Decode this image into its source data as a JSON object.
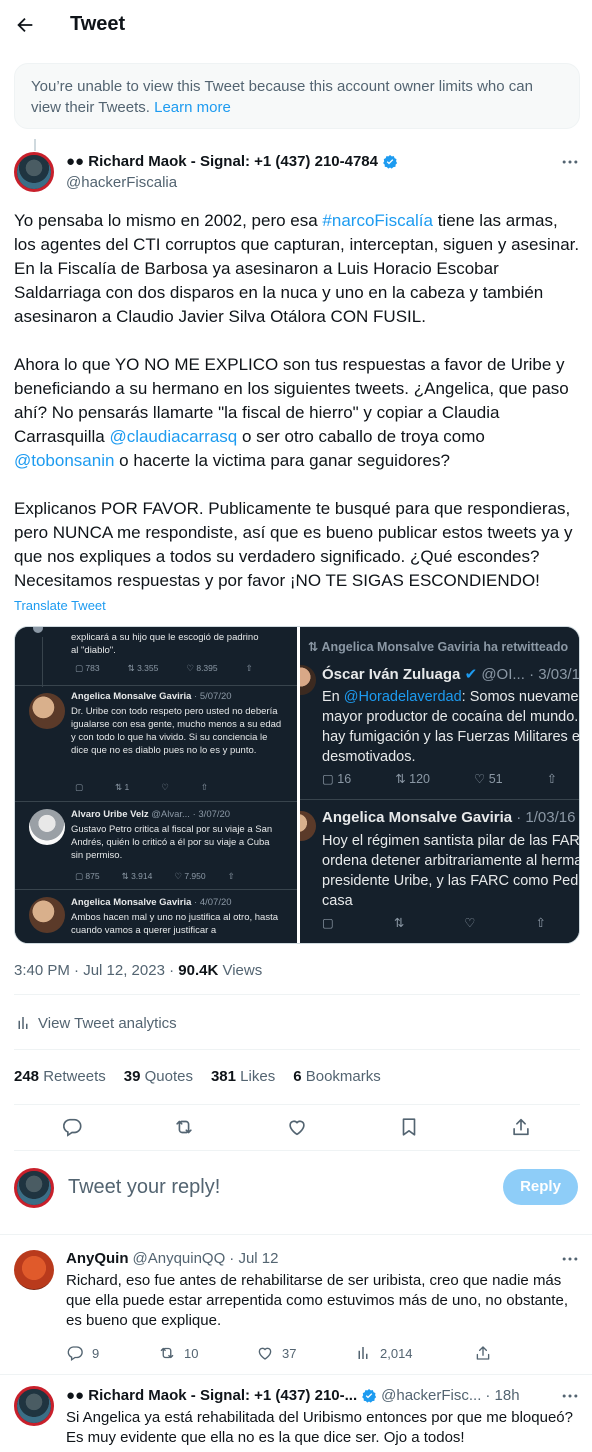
{
  "header": {
    "title": "Tweet"
  },
  "notice": {
    "text": "You’re unable to view this Tweet because this account owner limits who can view their Tweets.",
    "link": "Learn more"
  },
  "tweet": {
    "display_name": "●● Richard Maok - Signal: +1 (437) 210-4784",
    "handle": "@hackerFiscalia",
    "paragraph1_a": "Yo pensaba lo mismo en 2002, pero esa ",
    "paragraph1_hashtag": "#narcoFiscalía",
    "paragraph1_b": " tiene las armas, los agentes del CTI corruptos que capturan, interceptan, siguen y asesinar. En la Fiscalía de Barbosa ya asesinaron a Luis Horacio Escobar Saldarriaga con dos disparos en la nuca y uno en la cabeza y también asesinaron a Claudio Javier Silva Otálora CON FUSIL.",
    "paragraph2_a": "Ahora lo que YO NO ME EXPLICO son tus respuestas a favor de Uribe y beneficiando a su hermano en los siguientes tweets. ¿Angelica, que paso ahí? No pensarás llamarte \"la fiscal de hierro\" y copiar a Claudia Carrasquilla ",
    "paragraph2_mention1": "@claudiacarrasq",
    "paragraph2_b": " o ser otro caballo de troya como ",
    "paragraph2_mention2": "@tobonsanin",
    "paragraph2_c": " o hacerte la victima para ganar seguidores?",
    "paragraph3": "Explicanos POR FAVOR. Publicamente te busqué para que respondieras, pero NUNCA me respondiste, así que es bueno publicar estos tweets ya y que nos expliques a todos su verdadero significado. ¿Qué escondes? Necesitamos respuestas y por favor ¡NO TE SIGAS ESCONDIENDO!",
    "translate": "Translate Tweet",
    "time": "3:40 PM · Jul 12, 2023 · ",
    "views_count": "90.4K",
    "views_label": " Views",
    "analytics": "View Tweet analytics",
    "retweets_count": "248",
    "retweets_label": "Retweets",
    "quotes_count": "39",
    "quotes_label": "Quotes",
    "likes_count": "381",
    "likes_label": "Likes",
    "bookmarks_count": "6",
    "bookmarks_label": "Bookmarks"
  },
  "media": {
    "left": {
      "top_text": "explicará a su hijo que le escogió de padrino al \"diablo\".",
      "top_stats": [
        "783",
        "3.355",
        "8.395"
      ],
      "t1_name": "Angelica Monsalve Gaviria",
      "t1_date": "· 5/07/20",
      "t1_text": "Dr. Uribe con todo respeto pero usted no debería igualarse con esa gente, mucho menos a su edad y con todo lo que ha vivido. Si su conciencia le dice que no es diablo pues no lo es y punto.",
      "t1_stats": [
        "",
        "1",
        ""
      ],
      "t2_name": "Alvaro Uribe Velz",
      "t2_handle": "@Alvar...",
      "t2_date": "· 3/07/20",
      "t2_text": "Gustavo Petro critica al fiscal por su viaje a San Andrés, quién lo criticó a él por su viaje a Cuba sin permiso.",
      "t2_stats": [
        "875",
        "3.914",
        "7.950"
      ],
      "t3_name": "Angelica Monsalve Gaviria",
      "t3_date": "· 4/07/20",
      "t3_text": "Ambos hacen mal y uno no justifica al otro, hasta cuando vamos a querer justificar a"
    },
    "right": {
      "rt_label": "Angelica Monsalve Gaviria ha retwitteado",
      "r1_name": "Óscar Iván Zuluaga",
      "r1_handle": "@OI...",
      "r1_date": "· 3/03/16",
      "r1_mention": "@Horadelaverdad",
      "r1_text_a": "En ",
      "r1_text_b": ": Somos nuevamente el mayor productor de cocaína del mundo. No hay fumigación y las Fuerzas Militares están desmotivados.",
      "r1_stats": [
        "16",
        "120",
        "51"
      ],
      "r2_name": "Angelica Monsalve Gaviria",
      "r2_date": "· 1/03/16",
      "r2_text": "Hoy el régimen santista pilar de las FARC ordena detener arbitrariamente al hermano del presidente Uribe, y las FARC como Pedro en casa"
    }
  },
  "reply": {
    "placeholder": "Tweet your reply!",
    "button": "Reply"
  },
  "comments": [
    {
      "name": "AnyQuin",
      "handle": "@AnyquinQQ",
      "date": "· Jul 12",
      "text": "Richard, eso fue antes de rehabilitarse de ser uribista, creo que nadie más que ella puede estar arrepentida como estuvimos más de uno, no obstante, es bueno que explique.",
      "replies": "9",
      "retweets": "10",
      "likes": "37",
      "views": "2,014"
    },
    {
      "name": "●● Richard Maok - Signal: +1 (437) 210-...",
      "handle": "@hackerFisc...",
      "date": "· 18h",
      "text": "Si Angelica ya está rehabilitada del Uribismo entonces por que me bloqueó? Es muy evidente que ella no es la que dice ser. Ojo a todos!"
    }
  ],
  "colors": {
    "accent": "#1d9bf0",
    "text": "#0f1419",
    "muted": "#536471",
    "reply_button": "#8ecdf8",
    "dark_card": "#15202b"
  }
}
